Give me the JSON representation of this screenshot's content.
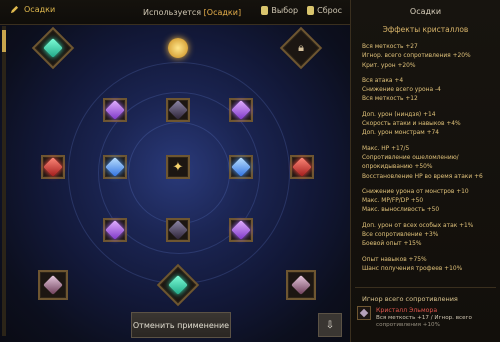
{
  "header": {
    "tab_label": "Осадки",
    "used_prefix": "Используется ",
    "used_value": "[Осадки]",
    "select_label": "Выбор",
    "reset_label": "Сброс"
  },
  "buttons": {
    "apply_cancel": "Отменить применение"
  },
  "right": {
    "title": "Осадки",
    "subtitle": "Эффекты кристаллов",
    "groups": [
      [
        "Вся меткость +27",
        "Игнор. всего сопротивления +20%",
        "Крит. урон +20%"
      ],
      [
        "Вся атака +4",
        "Снижение всего урона -4",
        "Вся меткость +12"
      ],
      [
        "Доп. урон (ниндзя) +14",
        "Скорость атаки и навыков +4%",
        "Доп. урон монстрам +74"
      ],
      [
        "Макс. HP +17/5",
        "Сопротивление ошеломлению/опрокидыванию +50%",
        "Восстановление HP во время атаки +6"
      ],
      [
        "Снижение урона от монстров +10",
        "Макс. MP/FP/DP +50",
        "Макс. выносливость +50"
      ],
      [
        "Доп. урон от всех особых атак +1%",
        "Все сопротивление +3%",
        "Боевой опыт +15%"
      ],
      [
        "Опыт навыков +75%",
        "Шанс получения трофеев +10%"
      ]
    ],
    "ignore_title": "Игнор всего сопротивления",
    "crystal_name": "Кристалл Эльмора",
    "crystal_line2": "Вся меткость +17 / Игнор. всего",
    "crystal_line3": "сопротивления +10%"
  },
  "icons": {
    "pencil": "pencil-icon",
    "lock": "lock-icon",
    "key": "key-icon",
    "download": "download-icon"
  }
}
